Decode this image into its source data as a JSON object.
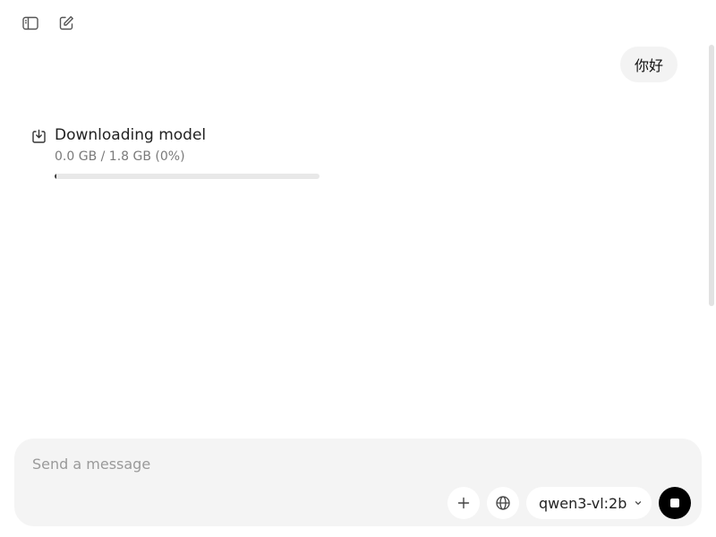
{
  "toolbar": {
    "sidebar_icon": "sidebar-icon",
    "new_chat_icon": "new-chat-icon"
  },
  "messages": [
    {
      "role": "user",
      "text": "你好"
    }
  ],
  "download": {
    "icon": "download-icon",
    "title": "Downloading model",
    "progress_text": "0.0 GB / 1.8 GB (0%)",
    "progress_fraction": 0.0
  },
  "composer": {
    "placeholder": "Send a message",
    "value": "",
    "attach_icon": "plus-icon",
    "web_icon": "globe-icon",
    "model": "qwen3-vl:2b",
    "stop_icon": "stop-icon"
  },
  "colors": {
    "composer_bg": "#f4f4f4",
    "bubble_bg": "#f3f3f3",
    "stop_bg": "#000000",
    "progress_track": "#e8e8e8",
    "progress_fill": "#3a3a3a"
  }
}
